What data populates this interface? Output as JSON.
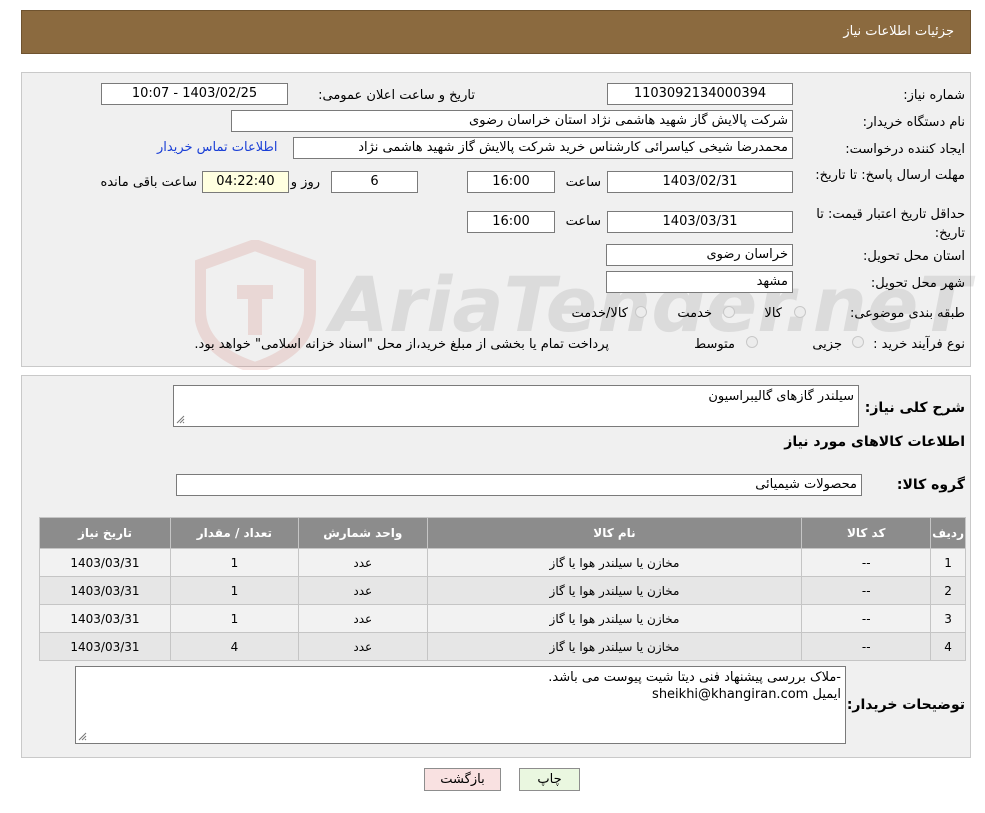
{
  "header": {
    "title": "جزئیات اطلاعات نیاز"
  },
  "form": {
    "need_number_label": "شماره نیاز:",
    "need_number": "1103092134000394",
    "announce_label": "تاریخ و ساعت اعلان عمومی:",
    "announce_value": "1403/02/25 - 10:07",
    "buyer_org_label": "نام دستگاه خریدار:",
    "buyer_org": "شرکت پالایش گاز شهید هاشمی نژاد   استان خراسان رضوی",
    "requester_label": "ایجاد کننده درخواست:",
    "requester": "محمدرضا شیخی کیاسرائی کارشناس خرید شرکت پالایش گاز شهید هاشمی نژاد",
    "contact_link": "اطلاعات تماس خریدار",
    "deadline_label": "مهلت ارسال پاسخ: تا تاریخ:",
    "deadline_date": "1403/02/31",
    "hour_label": "ساعت",
    "deadline_time": "16:00",
    "days_value": "6",
    "days_label": "روز و",
    "remaining_time": "04:22:40",
    "remaining_label": "ساعت باقی مانده",
    "validity_label": "حداقل تاریخ اعتبار قیمت: تا تاریخ:",
    "validity_date": "1403/03/31",
    "validity_time": "16:00",
    "province_label": "استان محل تحویل:",
    "province": "خراسان رضوی",
    "city_label": "شهر محل تحویل:",
    "city": "مشهد",
    "category_label": "طبقه بندی موضوعی:",
    "category_options": [
      "کالا",
      "خدمت",
      "کالا/خدمت"
    ],
    "process_label": "نوع فرآیند خرید :",
    "process_options": [
      "جزیی",
      "متوسط"
    ],
    "process_note": "پرداخت تمام یا بخشی از مبلغ خرید،از محل \"اسناد خزانه اسلامی\" خواهد بود."
  },
  "description": {
    "label": "شرح کلی نیاز:",
    "value": "سیلندر گازهای گالیبراسیون"
  },
  "goods": {
    "section_title": "اطلاعات کالاهای مورد نیاز",
    "group_label": "گروه کالا:",
    "group_value": "محصولات شیمیائی",
    "table": {
      "headers": [
        "ردیف",
        "کد کالا",
        "نام کالا",
        "واحد شمارش",
        "تعداد / مقدار",
        "تاریخ نیاز"
      ],
      "rows": [
        [
          "1",
          "--",
          "مخازن یا سیلندر هوا یا گاز",
          "عدد",
          "1",
          "1403/03/31"
        ],
        [
          "2",
          "--",
          "مخازن یا سیلندر هوا یا گاز",
          "عدد",
          "1",
          "1403/03/31"
        ],
        [
          "3",
          "--",
          "مخازن یا سیلندر هوا یا گاز",
          "عدد",
          "1",
          "1403/03/31"
        ],
        [
          "4",
          "--",
          "مخازن یا سیلندر هوا یا گاز",
          "عدد",
          "4",
          "1403/03/31"
        ]
      ]
    }
  },
  "buyer_notes": {
    "label": "توضیحات خریدار:",
    "line1": "-ملاک بررسی پیشنهاد فنی دیتا شیت پیوست می باشد.",
    "line2": "ایمیل sheikhi@khangiran.com"
  },
  "buttons": {
    "print": "چاپ",
    "back": "بازگشت"
  },
  "watermark": {
    "text": "AriaTender.neT"
  },
  "colors": {
    "header_bg": "#8b6a3f",
    "link": "#1a3fd6",
    "table_header": "#8c8c8c",
    "print_btn": "#eaf7e0",
    "back_btn": "#f9e1e1"
  }
}
